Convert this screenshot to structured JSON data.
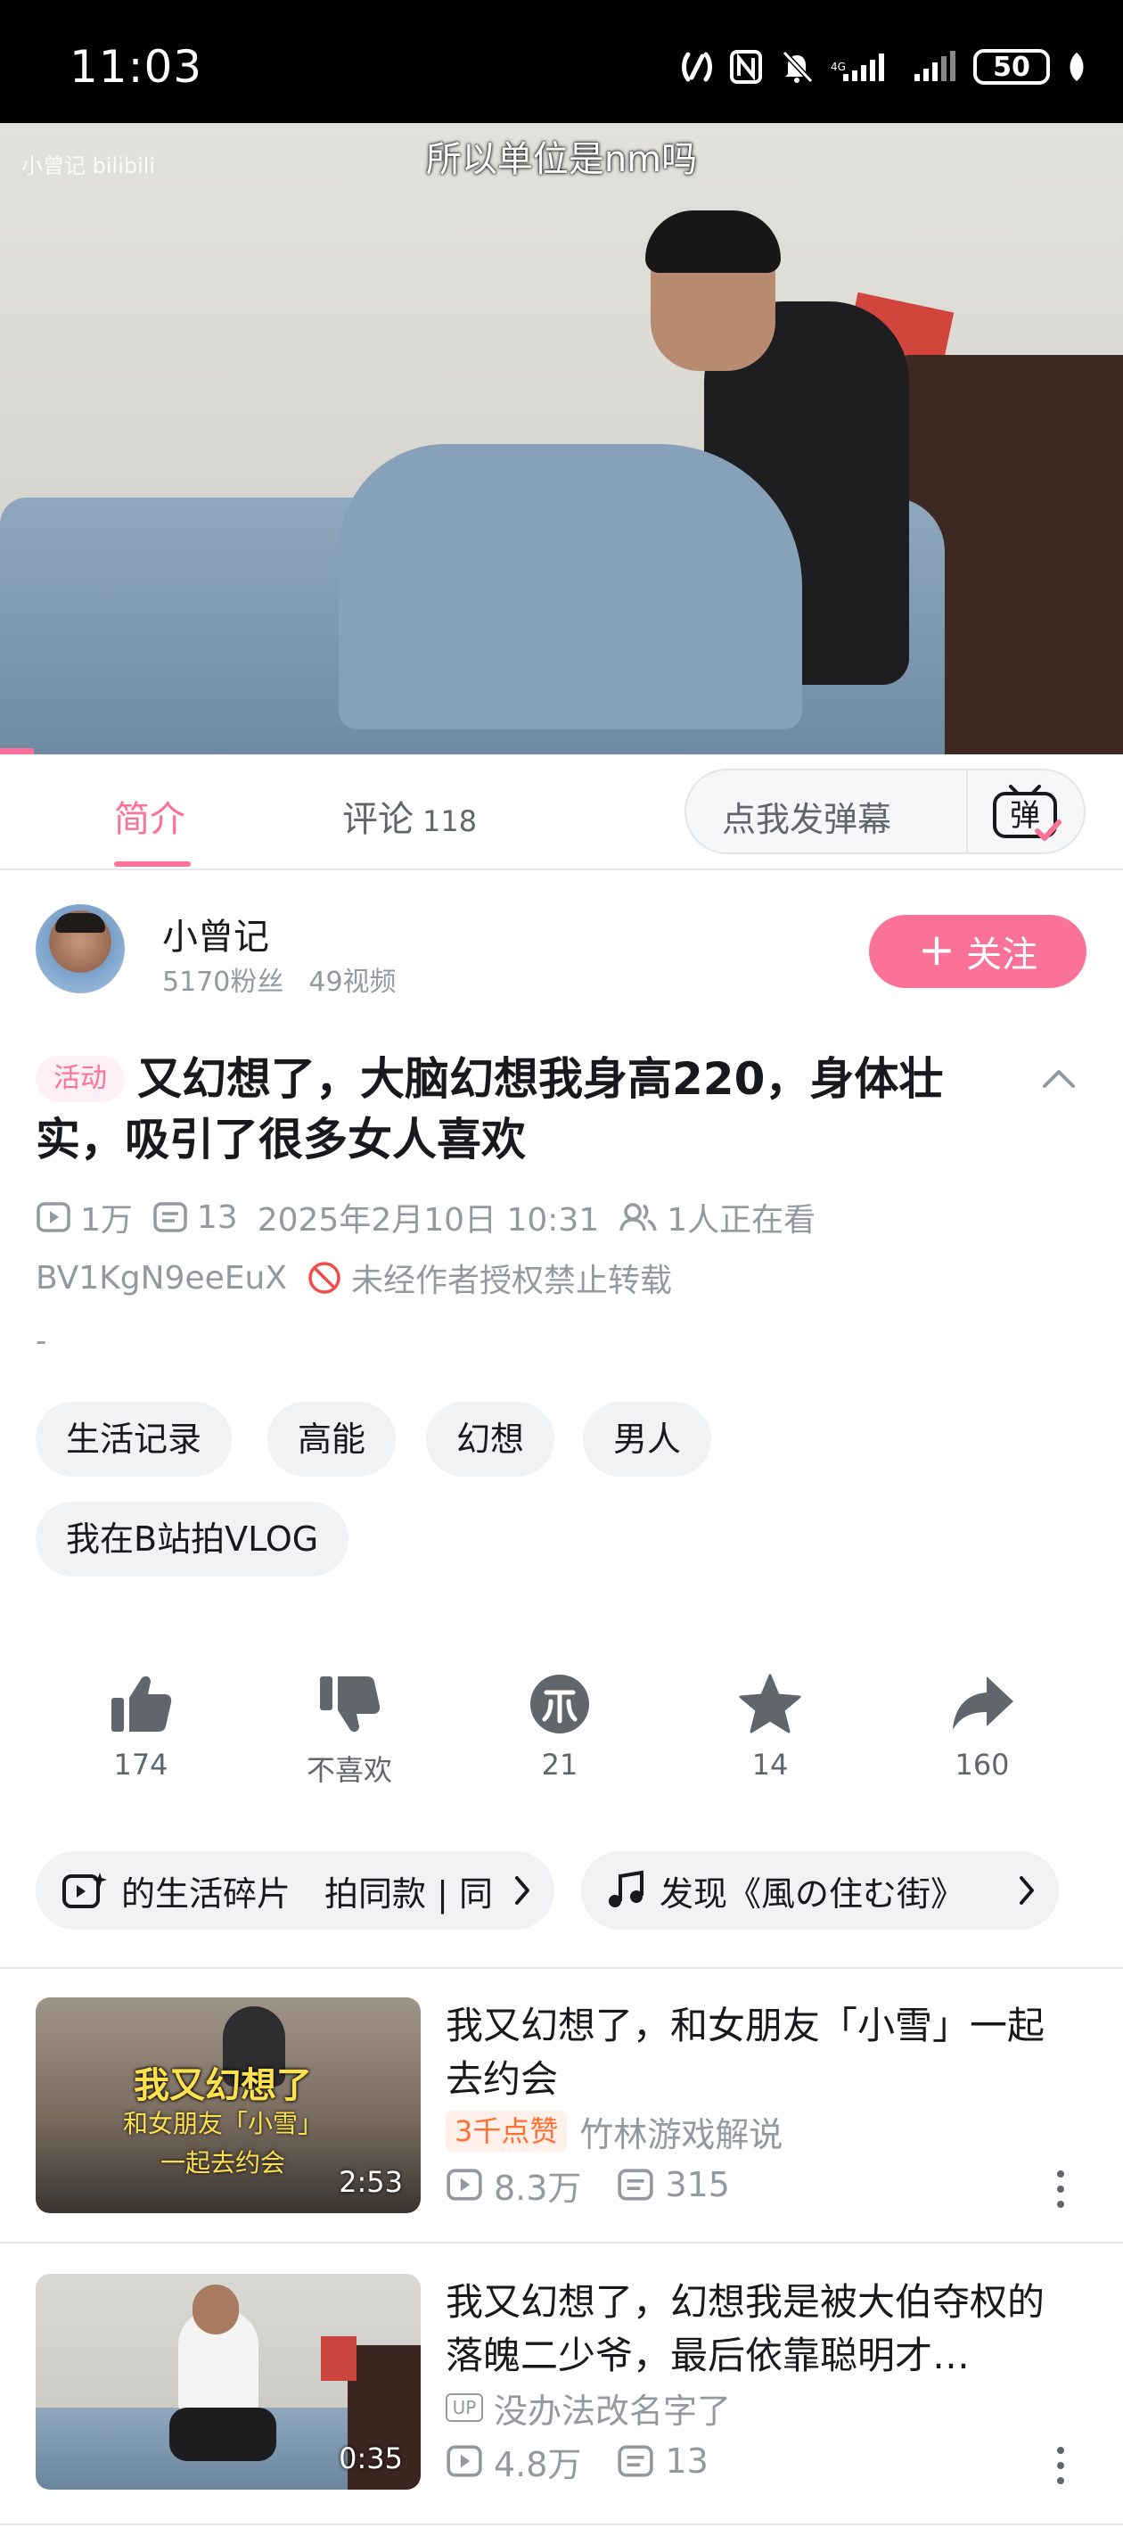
{
  "status_bar": {
    "time": "11:03",
    "battery": "50",
    "icons": [
      "nfc-icon",
      "n-icon",
      "mute-icon",
      "signal-4g-icon",
      "signal-icon",
      "battery-icon",
      "leaf-icon"
    ]
  },
  "player": {
    "subtitle": "所以单位是nm吗",
    "watermark": "小曾记 bilibili",
    "progress_fraction": 0.03
  },
  "tabs": {
    "intro": "简介",
    "comments": "评论",
    "comments_count": "118",
    "danmaku_placeholder": "点我发弹幕",
    "danmaku_icon_char": "弹"
  },
  "uploader": {
    "name": "小曾记",
    "fans": "5170粉丝",
    "videos": "49视频",
    "follow_label": "关注"
  },
  "video": {
    "activity_tag": "活动",
    "title": "又幻想了，大脑幻想我身高220，身体壮实，吸引了很多女人喜欢",
    "views": "1万",
    "danmaku": "13",
    "date": "2025年2月10日 10:31",
    "watching": "1人正在看",
    "bvid": "BV1KgN9eeEuX",
    "copyright": "未经作者授权禁止转载",
    "description": "-",
    "tags": [
      "生活记录",
      "高能",
      "幻想",
      "男人",
      "我在B站拍VLOG"
    ]
  },
  "actions": [
    {
      "name": "like",
      "label": "174"
    },
    {
      "name": "dislike",
      "label": "不喜欢"
    },
    {
      "name": "coin",
      "label": "21"
    },
    {
      "name": "favorite",
      "label": "14"
    },
    {
      "name": "share",
      "label": "160"
    }
  ],
  "chips": {
    "left": "的生活碎片　拍同款 | 同",
    "right": "发现《風の住む街》"
  },
  "recommendations": [
    {
      "title": "我又幻想了，和女朋友「小雪」一起去约会",
      "badge": "3千点赞",
      "author": "竹林游戏解说",
      "views": "8.3万",
      "danmaku": "315",
      "duration": "2:53",
      "thumb_text": [
        "我又幻想了",
        "和女朋友「小雪」",
        "一起去约会"
      ]
    },
    {
      "title": "我又幻想了，幻想我是被大伯夺权的落魄二少爷，最后依靠聪明才…",
      "author": "没办法改名字了",
      "views": "4.8万",
      "danmaku": "13",
      "duration": "0:35",
      "up_badge": "UP"
    }
  ],
  "colors": {
    "accent": "#fb7299",
    "text": "#18191c",
    "secondary": "#9499a0",
    "hot": "#ff6f32"
  }
}
